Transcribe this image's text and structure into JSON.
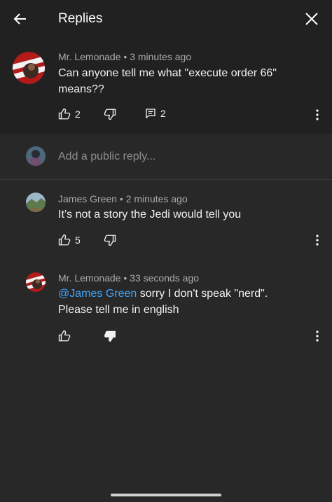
{
  "header": {
    "title": "Replies",
    "back_icon": "arrow-left-icon",
    "close_icon": "close-icon"
  },
  "colors": {
    "background": "#282828",
    "header_background": "#212121",
    "mention": "#3ea6ff",
    "meta_text": "#aaaaaa"
  },
  "parent_comment": {
    "author_meta": "Mr. Lemonade • 3 minutes ago",
    "text": "Can anyone tell me what \"execute order 66\" means??",
    "likes": "2",
    "replies": "2"
  },
  "reply_box": {
    "placeholder": "Add a public reply..."
  },
  "replies": [
    {
      "author_meta": "James Green • 2 minutes ago",
      "text": "It’s not a story the Jedi would tell you",
      "likes": "5"
    },
    {
      "author_meta": "Mr. Lemonade • 33 seconds ago",
      "mention": "@James Green",
      "text": " sorry I don't speak \"nerd\". Please tell me in english",
      "disliked": true
    }
  ]
}
